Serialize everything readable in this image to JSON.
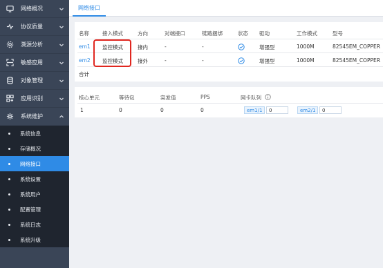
{
  "sidebar": {
    "items": [
      {
        "label": "网络概况",
        "icon": "monitor-icon"
      },
      {
        "label": "协议质量",
        "icon": "pulse-icon"
      },
      {
        "label": "溯源分析",
        "icon": "gear-icon"
      },
      {
        "label": "敏感应用",
        "icon": "scan-icon"
      },
      {
        "label": "对象管理",
        "icon": "database-icon"
      },
      {
        "label": "应用识别",
        "icon": "apps-icon"
      },
      {
        "label": "系统维护",
        "icon": "settings-icon"
      }
    ],
    "submenu": [
      "系统信息",
      "存储概况",
      "网络接口",
      "系统设置",
      "系统用户",
      "配置管理",
      "系统日志",
      "系统升级"
    ],
    "active_sub": "网络接口"
  },
  "tabs": {
    "active": "网络接口"
  },
  "interfaces": {
    "headers": [
      "名称",
      "接入模式",
      "方向",
      "对端接口",
      "链路捆绑",
      "状态",
      "驱动",
      "工作模式",
      "型号"
    ],
    "rows": [
      {
        "name": "em1",
        "mode": "监控模式",
        "direction": "接内",
        "peer": "-",
        "bond": "-",
        "status": "ok",
        "driver": "增强型",
        "work_mode": "1000M",
        "model": "82545EM_COPPER"
      },
      {
        "name": "em2",
        "mode": "监控模式",
        "direction": "接外",
        "peer": "-",
        "bond": "-",
        "status": "ok",
        "driver": "增强型",
        "work_mode": "1000M",
        "model": "82545EM_COPPER"
      }
    ],
    "total_label": "合计"
  },
  "core": {
    "headers": [
      "核心单元",
      "等待包",
      "突发值",
      "PPS",
      "网卡队列"
    ],
    "row": {
      "unit": "1",
      "pending": "0",
      "burst": "0",
      "pps": "0"
    },
    "queues": [
      {
        "label": "em1/1",
        "value": "0"
      },
      {
        "label": "em2/1",
        "value": "0"
      }
    ]
  },
  "colors": {
    "accent": "#2f8be6",
    "annotation": "#e0261f",
    "sidebar": "#3a4557"
  }
}
